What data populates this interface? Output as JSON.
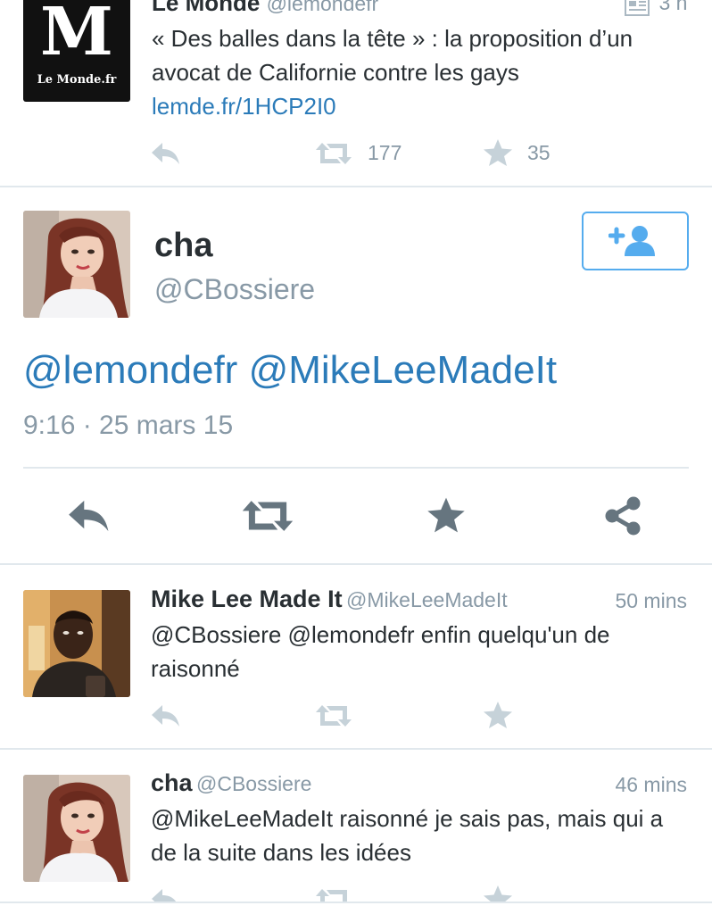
{
  "colors": {
    "link": "#2b7bb9",
    "icon_gray": "#aab8c2",
    "icon_dark": "#66757f",
    "separator": "#e1e8ed"
  },
  "tweet1": {
    "author": "Le Monde",
    "handle": "@lemondefr",
    "time": "3 h",
    "text_main": "« Des balles dans la tête » : la proposition d’un avocat de Californie contre les gays ",
    "link": "lemde.fr/1HCP2I0",
    "avatar_text": "Le Monde.fr",
    "avatar_glyph": "M",
    "retweets": "177",
    "favorites": "35"
  },
  "focus_tweet": {
    "author": "cha",
    "handle": "@CBossiere",
    "mentions": [
      "@lemondefr",
      "@MikeLeeMadeIt"
    ],
    "timestamp": "9:16 · 25 mars 15"
  },
  "replies": [
    {
      "author": "Mike Lee Made It",
      "handle": "@MikeLeeMadeIt",
      "time": "50 mins",
      "text": "@CBossiere @lemondefr enfin quelqu'un de raisonné"
    },
    {
      "author": "cha",
      "handle": "@CBossiere",
      "time": "46 mins",
      "text": "@MikeLeeMadeIt raisonné je sais pas, mais qui a de la suite dans les idées"
    }
  ]
}
